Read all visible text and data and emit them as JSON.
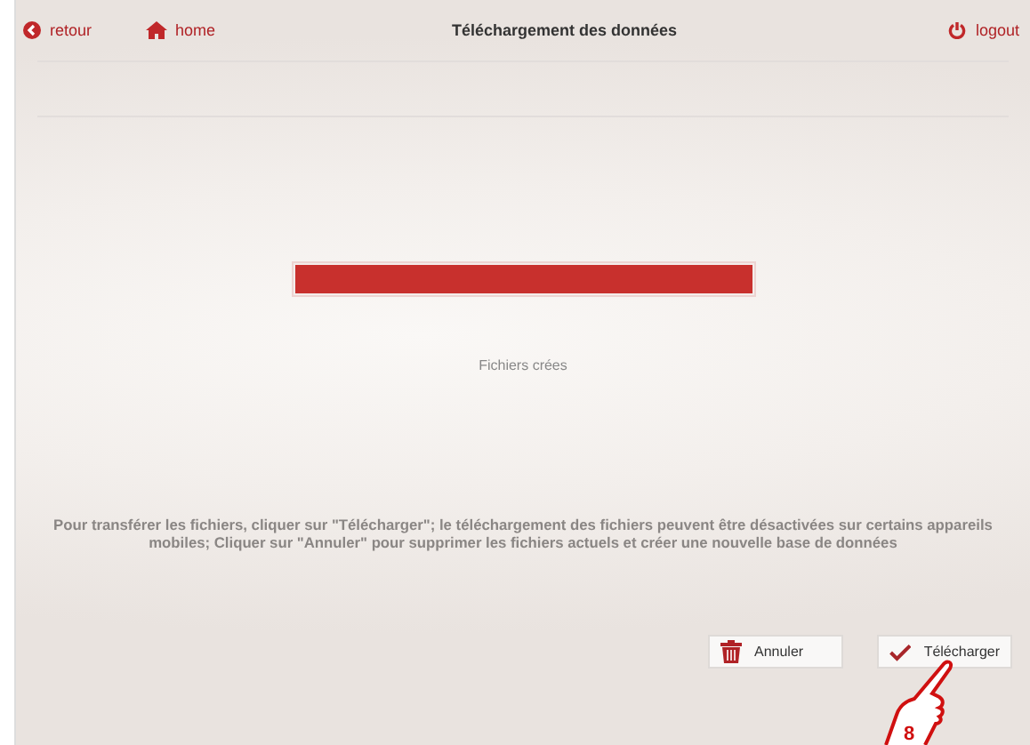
{
  "header": {
    "back": "retour",
    "home": "home",
    "title": "Téléchargement des données",
    "logout": "logout"
  },
  "progress": {
    "level": 1.0,
    "status": "Fichiers crées"
  },
  "instructions": "Pour transférer les fichiers, cliquer sur \"Télécharger\"; le téléchargement des fichiers peuvent être désactivées sur certains appareils mobiles; Cliquer sur \"Annuler\" pour supprimer les fichiers actuels et créer une nouvelle base de données",
  "buttons": [
    {
      "kind": "cancel",
      "label": "Annuler"
    },
    {
      "kind": "confirm",
      "label": "Télécharger"
    }
  ],
  "annotation": {
    "label": "8"
  }
}
